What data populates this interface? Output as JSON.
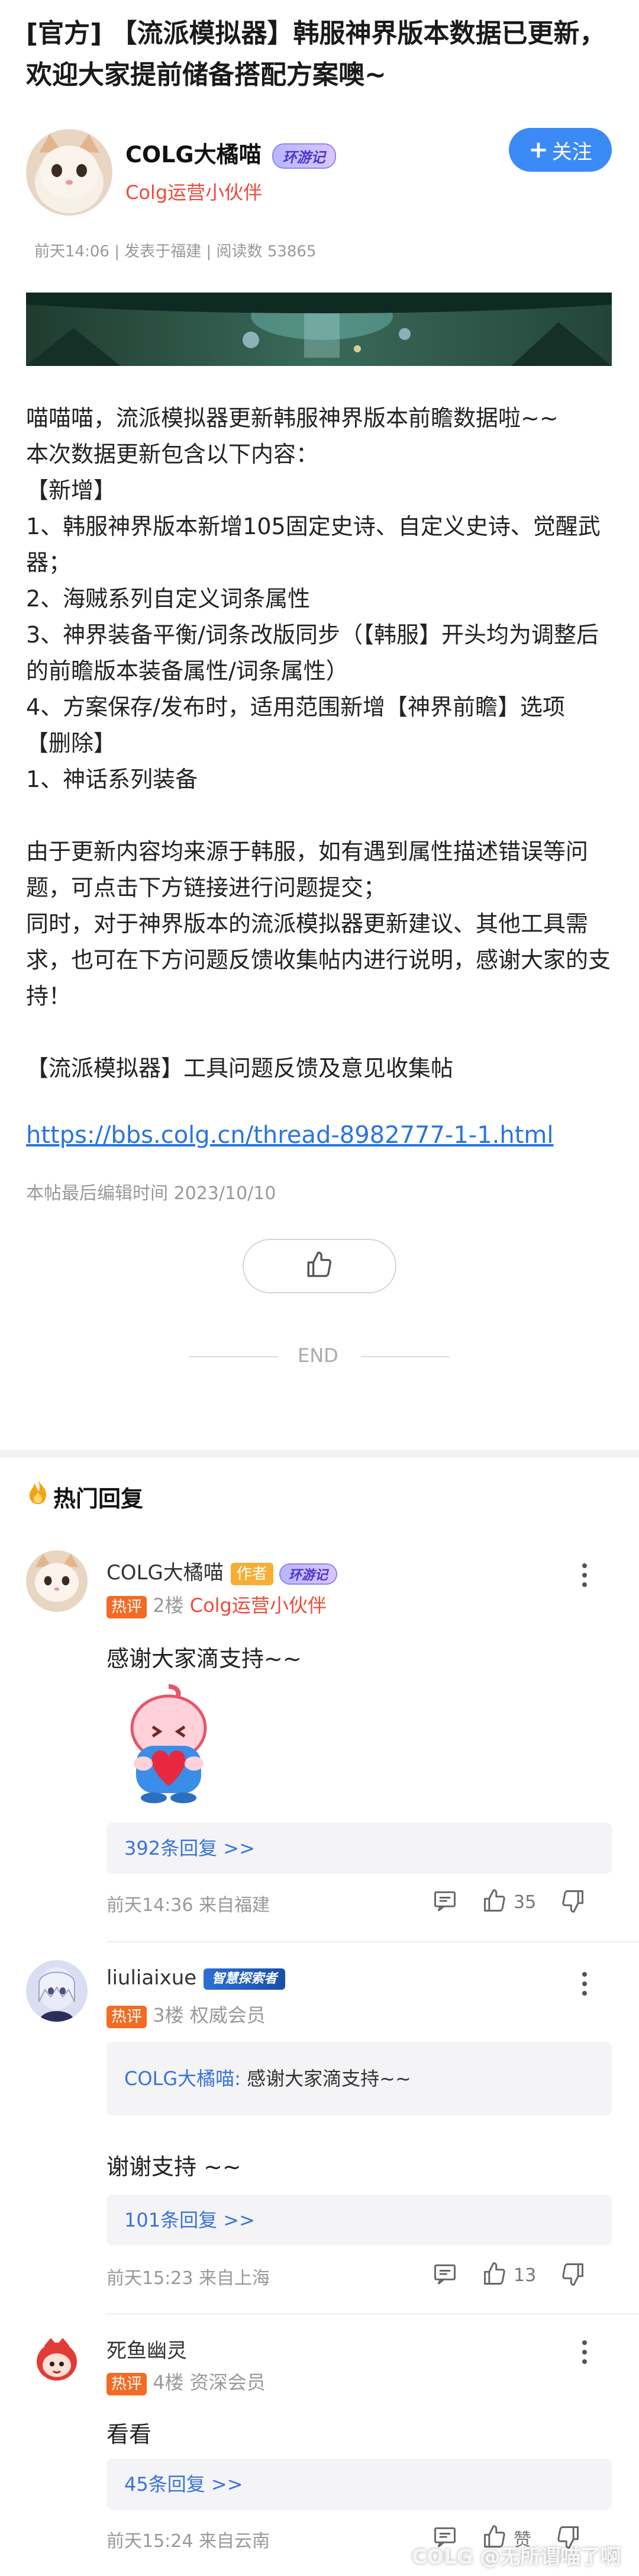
{
  "post": {
    "title": "[官方] 【流派模拟器】韩服神界版本数据已更新，欢迎大家提前储备搭配方案噢~",
    "author": {
      "name": "COLG大橘喵",
      "badge": "环游记",
      "subtitle": "Colg运营小伙伴",
      "follow_label": "关注"
    },
    "meta": "前天14:06 | 发表于福建 | 阅读数 53865",
    "body_lines": [
      "喵喵喵，流派模拟器更新韩服神界版本前瞻数据啦~~",
      "本次数据更新包含以下内容：",
      "【新增】",
      "1、韩服神界版本新增105固定史诗、自定义史诗、觉醒武器；",
      "2、海贼系列自定义词条属性",
      "3、神界装备平衡/词条改版同步（【韩服】开头均为调整后的前瞻版本装备属性/词条属性）",
      "4、方案保存/发布时，适用范围新增【神界前瞻】选项",
      "【删除】",
      "1、神话系列装备",
      "",
      "由于更新内容均来源于韩服，如有遇到属性描述错误等问题，可点击下方链接进行问题提交；",
      "同时，对于神界版本的流派模拟器更新建议、其他工具需求，也可在下方问题反馈收集帖内进行说明，感谢大家的支持！",
      "",
      "【流派模拟器】工具问题反馈及意见收集帖"
    ],
    "link": "https://bbs.colg.cn/thread-8982777-1-1.html",
    "edit_time": "本帖最后编辑时间 2023/10/10",
    "end_label": "END"
  },
  "hot": {
    "title": "热门回复",
    "replies": [
      {
        "name": "COLG大橘喵",
        "author_tag": "作者",
        "badge": "环游记",
        "hot_tag": "热评",
        "floor": "2楼",
        "role": "Colg运营小伙伴",
        "text": "感谢大家滴支持~~",
        "replies_label": "392条回复 >>",
        "time": "前天14:36 来自福建",
        "likes": "35"
      },
      {
        "name": "liuliaixue",
        "badge": "智慧探索者",
        "hot_tag": "热评",
        "floor": "3楼",
        "role": "权威会员",
        "quote_name": "COLG大橘喵:",
        "quote_text": " 感谢大家滴支持~~",
        "text": "谢谢支持 ~~",
        "replies_label": "101条回复 >>",
        "time": "前天15:23 来自上海",
        "likes": "13"
      },
      {
        "name": "死鱼幽灵",
        "hot_tag": "热评",
        "floor": "4楼",
        "role": "资深会员",
        "text": "看看",
        "replies_label": "45条回复 >>",
        "time": "前天15:24 来自云南",
        "likes": "赞"
      }
    ]
  },
  "watermark": "COLG @无所谓喵了啊",
  "colors": {
    "accent_blue": "#3c8af6",
    "link_blue": "#2a74e0",
    "hot_orange": "#f36b24",
    "author_tag": "#f7ae35",
    "role_red": "#f04a3b"
  }
}
